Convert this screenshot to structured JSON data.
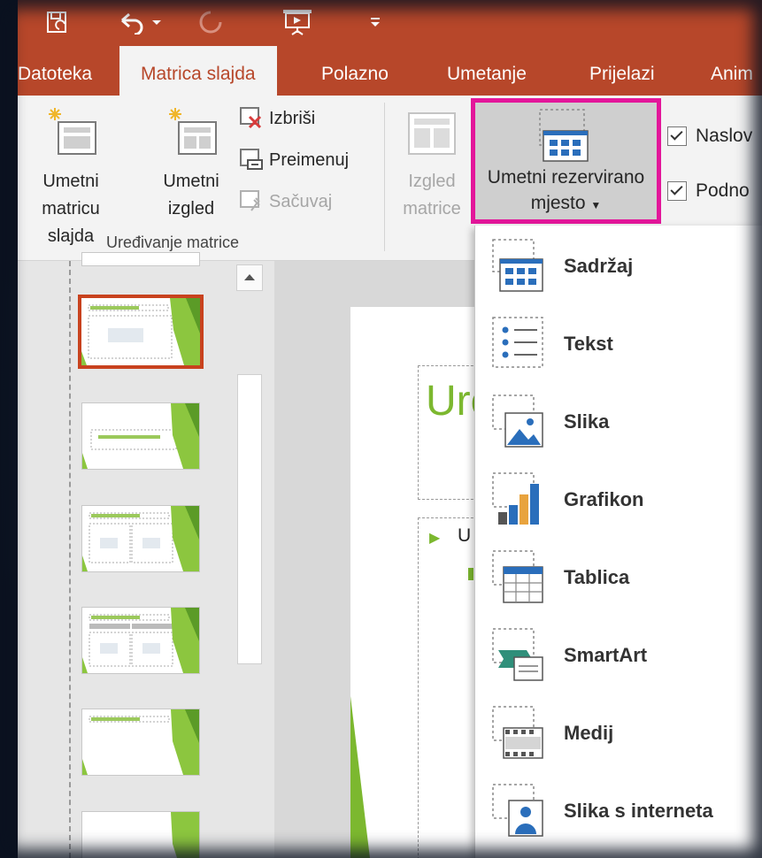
{
  "tabs": [
    {
      "label": "Datoteka",
      "active": false
    },
    {
      "label": "Matrica slajda",
      "active": true
    },
    {
      "label": "Polazno",
      "active": false
    },
    {
      "label": "Umetanje",
      "active": false
    },
    {
      "label": "Prijelazi",
      "active": false
    },
    {
      "label": "Anim",
      "active": false
    }
  ],
  "ribbon": {
    "insert_master": {
      "line1": "Umetni",
      "line2": "matricu slajda"
    },
    "insert_layout": {
      "line1": "Umetni",
      "line2": "izgled"
    },
    "delete": "Izbriši",
    "rename": "Preimenuj",
    "preserve": "Sačuvaj",
    "group_label": "Uređivanje matrice",
    "master_layout": {
      "line1": "Izgled",
      "line2": "matrice"
    },
    "insert_placeholder": {
      "line1": "Umetni rezervirano",
      "line2": "mjesto"
    },
    "check_title": "Naslov",
    "check_footer": "Podno"
  },
  "slide_text": {
    "title": "Ure",
    "bullet": "U"
  },
  "dropdown": [
    {
      "label": "Sadržaj",
      "icon": "content-placeholder-icon"
    },
    {
      "label": "Tekst",
      "icon": "text-placeholder-icon"
    },
    {
      "label": "Slika",
      "icon": "picture-placeholder-icon"
    },
    {
      "label": "Grafikon",
      "icon": "chart-placeholder-icon"
    },
    {
      "label": "Tablica",
      "icon": "table-placeholder-icon"
    },
    {
      "label": "SmartArt",
      "icon": "smartart-placeholder-icon"
    },
    {
      "label": "Medij",
      "icon": "media-placeholder-icon"
    },
    {
      "label": "Slika s interneta",
      "icon": "online-picture-placeholder-icon"
    }
  ],
  "colors": {
    "accent": "#b7472a",
    "highlight": "#e3169a",
    "slide_green": "#7cb82f",
    "selected_thumb": "#c8421e"
  }
}
